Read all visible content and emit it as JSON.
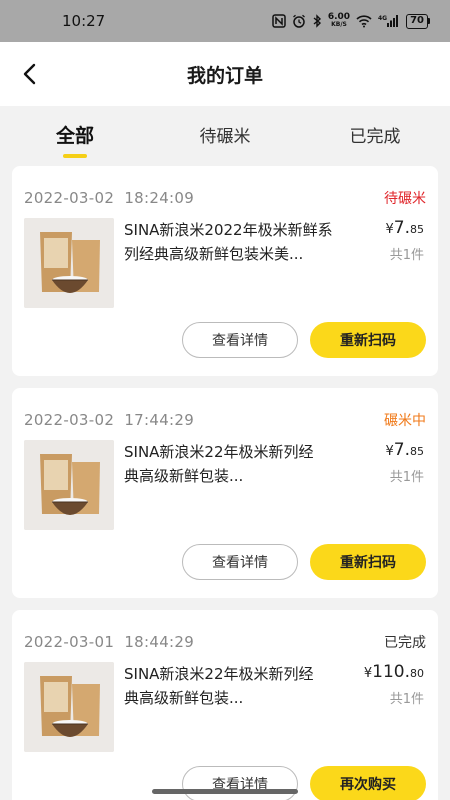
{
  "status_bar": {
    "time": "10:27",
    "net_speed_value": "6.00",
    "net_speed_unit": "KB/S",
    "signal_label": "4G",
    "battery": "70"
  },
  "nav": {
    "title": "我的订单",
    "back_icon": "chevron-left-icon"
  },
  "tabs": [
    {
      "label": "全部",
      "active": true
    },
    {
      "label": "待碾米",
      "active": false
    },
    {
      "label": "已完成",
      "active": false
    }
  ],
  "orders": [
    {
      "date": "2022-03-02",
      "time": "18:24:09",
      "status": "待碾米",
      "status_color": "#e0262b",
      "product_name": "SINA新浪米2022年极米新鲜系列经典高级新鲜包装米美...",
      "price_symbol": "¥",
      "price_int": "7.",
      "price_dec": "85",
      "quantity": "共1件",
      "btn_detail": "查看详情",
      "btn_action": "重新扫码"
    },
    {
      "date": "2022-03-02",
      "time": "17:44:29",
      "status": "碾米中",
      "status_color": "#f07a1a",
      "product_name": "SINA新浪米22年极米新列经典高级新鲜包装...",
      "price_symbol": "¥",
      "price_int": "7.",
      "price_dec": "85",
      "quantity": "共1件",
      "btn_detail": "查看详情",
      "btn_action": "重新扫码"
    },
    {
      "date": "2022-03-01",
      "time": "18:44:29",
      "status": "已完成",
      "status_color": "#333333",
      "product_name": "SINA新浪米22年极米新列经典高级新鲜包装...",
      "price_symbol": "¥",
      "price_int": "110.",
      "price_dec": "80",
      "quantity": "共1件",
      "btn_detail": "查看详情",
      "btn_action": "再次购买"
    }
  ],
  "colors": {
    "accent": "#fbd81a",
    "background": "#f2f2f2"
  }
}
